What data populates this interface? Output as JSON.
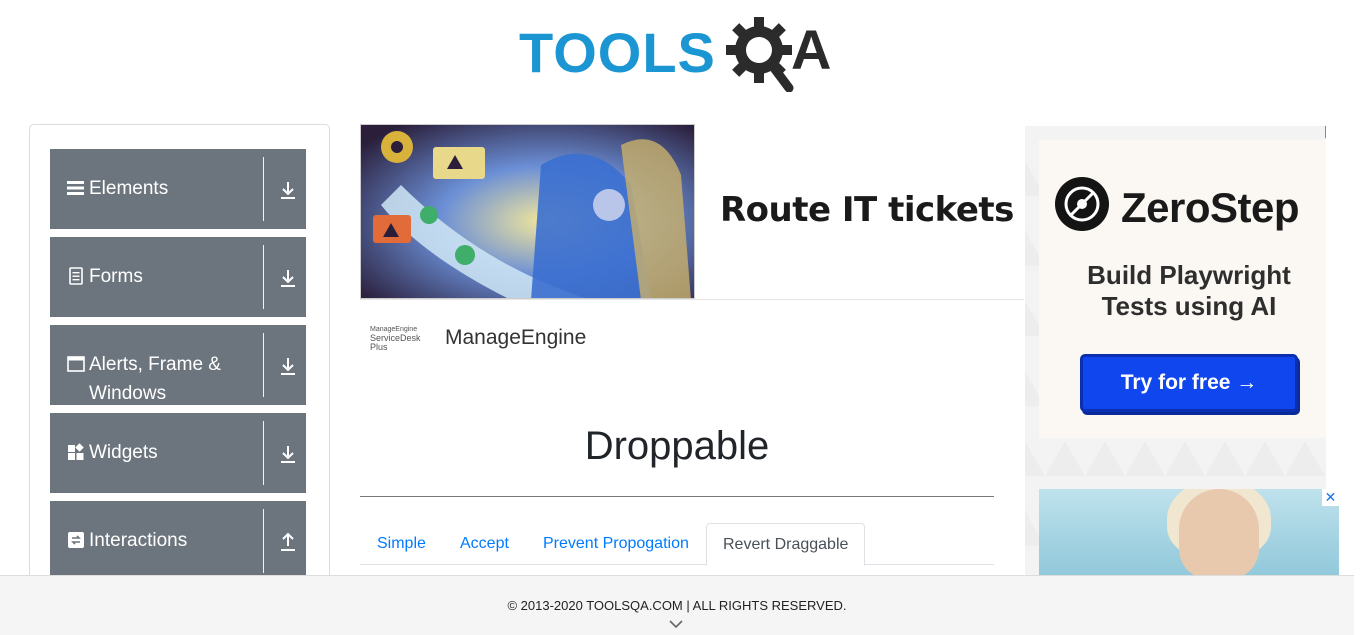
{
  "header": {
    "logo_text": "TOOLS",
    "logo_suffix": "A"
  },
  "sidebar": {
    "groups": [
      {
        "label": "Elements",
        "icon": "hamburger-icon",
        "arrow": "download-arrow-icon"
      },
      {
        "label": "Forms",
        "icon": "document-icon",
        "arrow": "download-arrow-icon"
      },
      {
        "label": "Alerts, Frame & Windows",
        "icon": "window-icon",
        "arrow": "download-arrow-icon"
      },
      {
        "label": "Widgets",
        "icon": "widgets-icon",
        "arrow": "download-arrow-icon"
      },
      {
        "label": "Interactions",
        "icon": "interactions-icon",
        "arrow": "upload-arrow-icon"
      }
    ]
  },
  "banner": {
    "headline": "Route IT tickets aut",
    "brand_logo_line1": "ManageEngine",
    "brand_logo_line2": "ServiceDesk Plus",
    "brand_name": "ManageEngine"
  },
  "main": {
    "title": "Droppable",
    "tabs": [
      {
        "label": "Simple",
        "active": false
      },
      {
        "label": "Accept",
        "active": false
      },
      {
        "label": "Prevent Propogation",
        "active": false
      },
      {
        "label": "Revert Draggable",
        "active": true
      }
    ]
  },
  "right_ad": {
    "brand": "ZeroStep",
    "tagline_line1": "Build Playwright",
    "tagline_line2": "Tests using AI",
    "cta": "Try for free →",
    "close": "✕"
  },
  "footer": {
    "copyright": "© 2013-2020 TOOLSQA.COM | ALL RIGHTS RESERVED."
  },
  "colors": {
    "sidebar_group": "#6c757d",
    "link": "#007bff",
    "logo_blue": "#1b96d2",
    "cta_blue": "#1046ee"
  }
}
